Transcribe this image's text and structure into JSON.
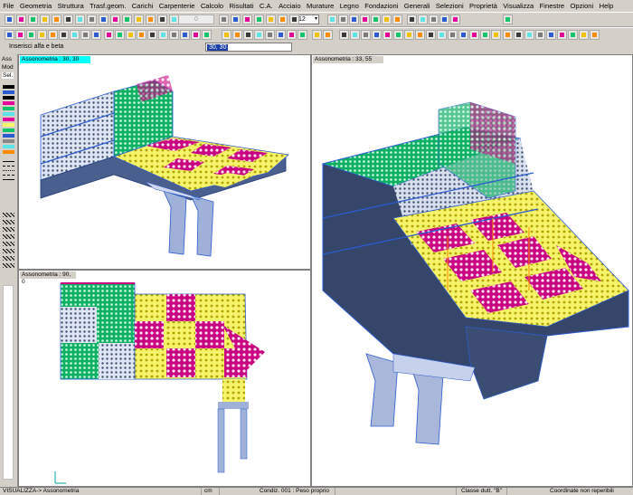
{
  "menu": [
    "File",
    "Geometria",
    "Struttura",
    "Trasf.geom.",
    "Carichi",
    "Carpenterie",
    "Calcolo",
    "Risultati",
    "C.A.",
    "Acciaio",
    "Murature",
    "Legno",
    "Fondazioni",
    "Generali",
    "Selezioni",
    "Proprietà",
    "Visualizza",
    "Finestre",
    "Opzioni",
    "Help"
  ],
  "toolbar": {
    "zoom_value": "12",
    "disabled_field": "0"
  },
  "command": {
    "prompt": "Inserisci alfa e beta",
    "value": "30, 30"
  },
  "left_panel": {
    "labels": [
      "Ass",
      "Mod",
      "Sel."
    ]
  },
  "colors": {
    "magenta": "#e3009a",
    "yellow": "#f7f56a",
    "green": "#11c46a",
    "cyan": "#5be3e7",
    "blue": "#2b5bd1",
    "steel": "#4a6fb2",
    "orange": "#ff8a00"
  },
  "viewports": {
    "top_left": {
      "label": "Assonometria : 30, 30"
    },
    "bottom_left": {
      "label": "Assonometria : 90, 0"
    },
    "right": {
      "label": "Assonometria : 33, 55"
    }
  },
  "status": {
    "mode": "VISUALIZZA-> Assonometria",
    "unit": "cm",
    "condition": "Condiz. 001 : Peso proprio",
    "class": "Classe dutt. \"B\"",
    "coords": "Coordinate non reperibili"
  }
}
